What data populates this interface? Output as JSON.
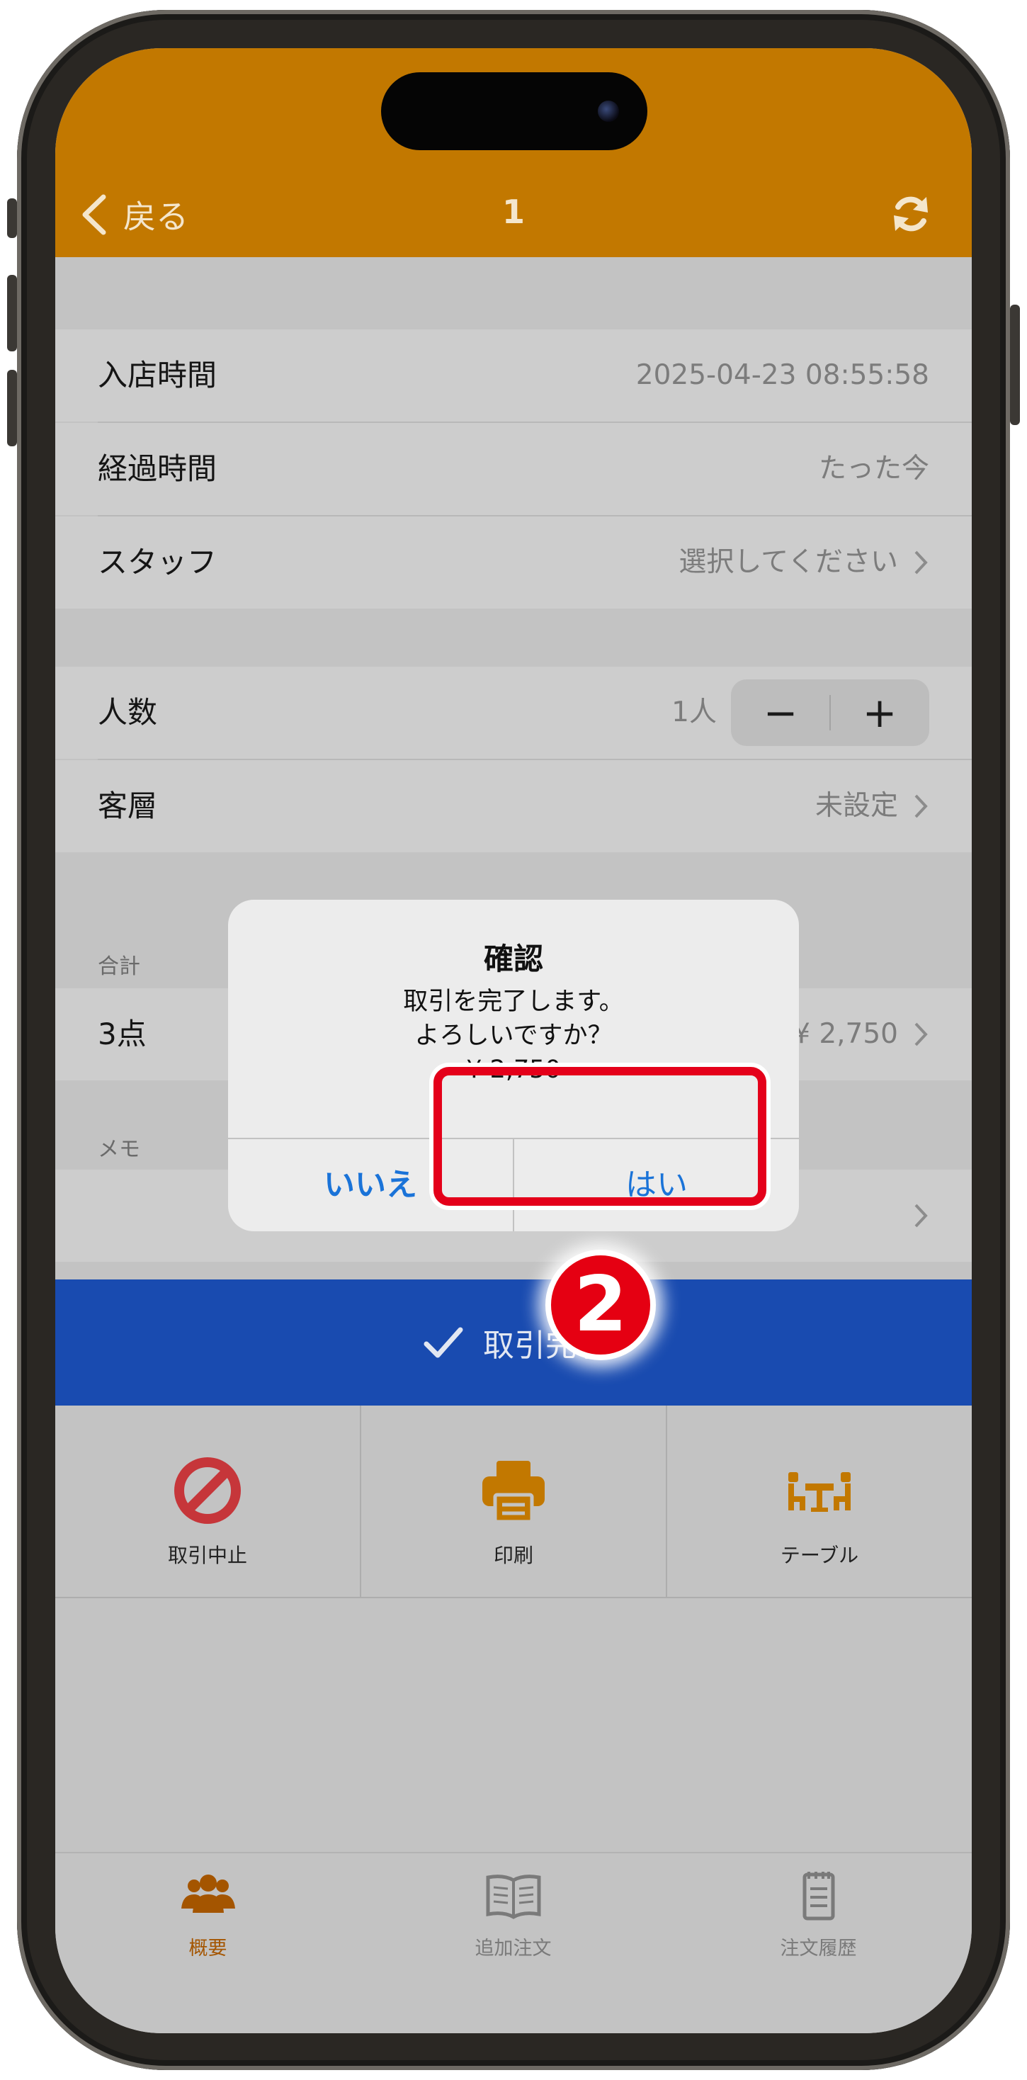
{
  "nav": {
    "back_label": "戻る",
    "title": "1",
    "back_icon": "chevron-left-icon",
    "refresh_icon": "refresh-icon"
  },
  "details": {
    "entry_time_label": "入店時間",
    "entry_time_value": "2025-04-23 08:55:58",
    "elapsed_label": "経過時間",
    "elapsed_value": "たった今",
    "staff_label": "スタッフ",
    "staff_value": "選択してください"
  },
  "guests": {
    "count_label": "人数",
    "count_value": "1人",
    "minus": "−",
    "plus": "+",
    "segment_label": "客層",
    "segment_value": "未設定"
  },
  "total": {
    "section_label": "合計",
    "items_label": "3点",
    "amount": "¥ 2,750"
  },
  "memo": {
    "section_label": "メモ"
  },
  "complete_button": {
    "label": "取引完了",
    "icon": "checkmark-icon"
  },
  "actions": [
    {
      "label": "取引中止",
      "icon": "prohibited-icon",
      "color": "#c6363a"
    },
    {
      "label": "印刷",
      "icon": "printer-icon",
      "color": "#c27800"
    },
    {
      "label": "テーブル",
      "icon": "table-seating-icon",
      "color": "#c27800"
    }
  ],
  "tabs": [
    {
      "label": "概要",
      "icon": "people-icon",
      "active": true
    },
    {
      "label": "追加注文",
      "icon": "menu-book-icon",
      "active": false
    },
    {
      "label": "注文履歴",
      "icon": "receipt-icon",
      "active": false
    }
  ],
  "alert": {
    "title": "確認",
    "message_line1": "取引を完了します。",
    "message_line2": "よろしいですか？",
    "message_line3": "¥ 2,750",
    "no_label": "いいえ",
    "yes_label": "はい"
  },
  "annotation": {
    "step_number": "2",
    "highlight_color": "#e4001a"
  },
  "colors": {
    "header": "#c27800",
    "complete_bar": "#194bb0",
    "alert_button": "#1a73d8"
  }
}
